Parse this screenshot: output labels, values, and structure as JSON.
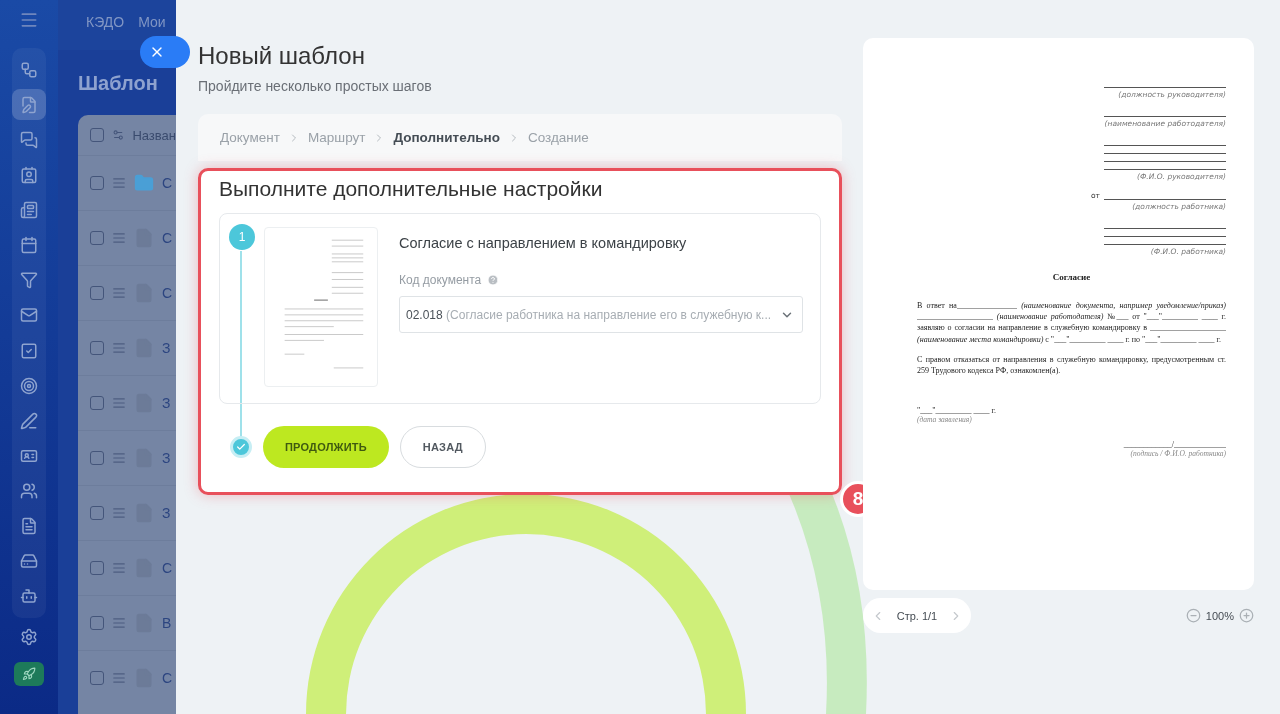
{
  "topbar": {
    "items": [
      "КЭДО",
      "Мои"
    ]
  },
  "page": {
    "title": "Шаблон",
    "table": {
      "column": "Назван",
      "all_checked": false,
      "rows": [
        {
          "kind": "folder",
          "text": "С",
          "checked": false
        },
        {
          "kind": "file",
          "text": "С",
          "checked": false
        },
        {
          "kind": "file",
          "text": "С",
          "checked": false
        },
        {
          "kind": "file",
          "text": "З",
          "checked": false
        },
        {
          "kind": "file",
          "text": "З",
          "checked": false
        },
        {
          "kind": "file",
          "text": "З",
          "checked": false
        },
        {
          "kind": "file",
          "text": "З",
          "checked": false
        },
        {
          "kind": "file",
          "text": "С",
          "checked": false
        },
        {
          "kind": "file",
          "text": "В",
          "checked": false
        },
        {
          "kind": "file",
          "text": "С",
          "checked": false
        }
      ]
    }
  },
  "modal": {
    "title": "Новый шаблон",
    "subtitle": "Пройдите несколько простых шагов",
    "steps": [
      {
        "label": "Документ",
        "selected": false
      },
      {
        "label": "Маршрут",
        "selected": false
      },
      {
        "label": "Дополнительно",
        "selected": true
      },
      {
        "label": "Создание",
        "selected": false
      }
    ],
    "section": {
      "title": "Выполните дополнительные настройки",
      "highlighted": true,
      "document": {
        "number": "1",
        "name": "Согласие с направлением в командировку",
        "field_label": "Код документа",
        "value": "02.018",
        "value_hint": "(Согласие работника на направление его в служебную к..."
      },
      "buttons": [
        {
          "label": "ПРОДОЛЖИТЬ",
          "kind": "primary"
        },
        {
          "label": "НАЗАД",
          "kind": "secondary"
        }
      ]
    },
    "annotation": "8"
  },
  "preview": {
    "header": [
      {
        "kind": "rule"
      },
      {
        "kind": "caption",
        "text": "(должность руководителя)"
      },
      {
        "kind": "rule"
      },
      {
        "kind": "caption",
        "text": "(наименование работодателя)"
      },
      {
        "kind": "rule"
      },
      {
        "kind": "rule"
      },
      {
        "kind": "rule"
      },
      {
        "kind": "rule"
      },
      {
        "kind": "caption",
        "text": "(Ф.И.О. руководителя)"
      },
      {
        "kind": "labeled_rule",
        "label": "от"
      },
      {
        "kind": "caption",
        "text": "(должность работника)"
      },
      {
        "kind": "rule"
      },
      {
        "kind": "rule"
      },
      {
        "kind": "rule"
      },
      {
        "kind": "caption",
        "text": "(Ф.И.О. работника)"
      }
    ],
    "title": "Согласие",
    "paragraphs": [
      "В ответ на_______________ *(наименование документа, например уведомление/приказ)* ___________________ *(наименование работодателя)* №___ от \"___\"_________ ____ г. заявляю о согласии на направление в служебную командировку в ___________________ *(наименование места командировки)* с \"___\"_________ ____ г. по \"___\"_________ ____ г.",
      "С правом отказаться от направления в служебную командировку, предусмотренным ст. 259 Трудового кодекса РФ, ознакомлен(а)."
    ],
    "date": {
      "text": "\"___\"_________ ____ г.",
      "caption": "(дата заявления)"
    },
    "signature": {
      "text": "____________/_____________",
      "caption": "(подпись / Ф.И.О. работника)"
    },
    "page_label": "Стр. 1/1",
    "zoom": "100%"
  }
}
